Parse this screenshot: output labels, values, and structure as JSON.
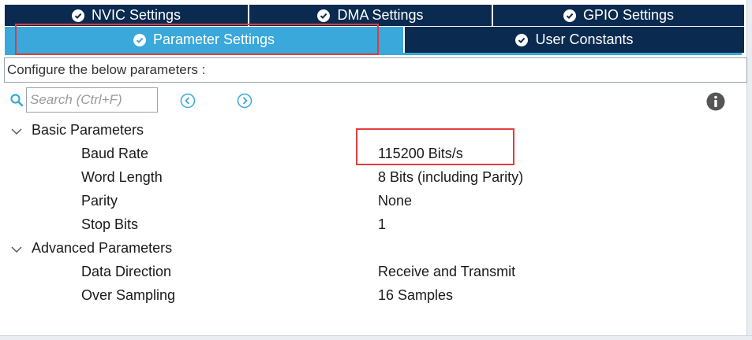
{
  "tabs": {
    "row1": [
      {
        "label": "NVIC Settings"
      },
      {
        "label": "DMA Settings"
      },
      {
        "label": "GPIO Settings"
      }
    ],
    "row2": [
      {
        "label": "Parameter Settings",
        "active": true
      },
      {
        "label": "User Constants"
      }
    ]
  },
  "configure_label": "Configure the below parameters :",
  "search": {
    "placeholder": "Search (Ctrl+F)"
  },
  "groups": [
    {
      "label": "Basic Parameters",
      "params": [
        {
          "name": "Baud Rate",
          "value": "115200 Bits/s"
        },
        {
          "name": "Word Length",
          "value": "8 Bits (including Parity)"
        },
        {
          "name": "Parity",
          "value": "None"
        },
        {
          "name": "Stop Bits",
          "value": "1"
        }
      ]
    },
    {
      "label": "Advanced Parameters",
      "params": [
        {
          "name": "Data Direction",
          "value": "Receive and Transmit"
        },
        {
          "name": "Over Sampling",
          "value": "16 Samples"
        }
      ]
    }
  ],
  "colors": {
    "tab_dark": "#0a2a4f",
    "tab_active": "#3aa8da",
    "highlight": "#e53b3b",
    "accent_icon": "#3aa8da",
    "info_icon": "#555555"
  },
  "icons": {
    "tab_status": "check-circle-icon",
    "search": "search-icon",
    "prev": "chevron-left-circle-icon",
    "next": "chevron-right-circle-icon",
    "info": "info-icon",
    "expand": "chevron-down-icon"
  }
}
